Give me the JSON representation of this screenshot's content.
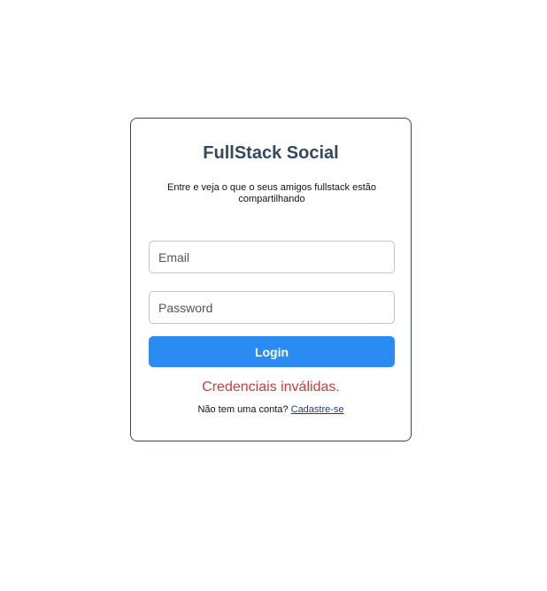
{
  "card": {
    "title": "FullStack Social",
    "subtitle": "Entre e veja o que o seus amigos fullstack estão compartilhando"
  },
  "form": {
    "email_placeholder": "Email",
    "email_value": "",
    "password_placeholder": "Password",
    "password_value": "",
    "login_label": "Login"
  },
  "error_message": "Credenciais inválidas.",
  "signup": {
    "prompt": "Não tem uma conta?",
    "link_label": "Cadastre-se"
  },
  "colors": {
    "title": "#34495e",
    "button": "#2a8bf2",
    "error": "#d63a3a",
    "link": "#1f3d7a"
  }
}
